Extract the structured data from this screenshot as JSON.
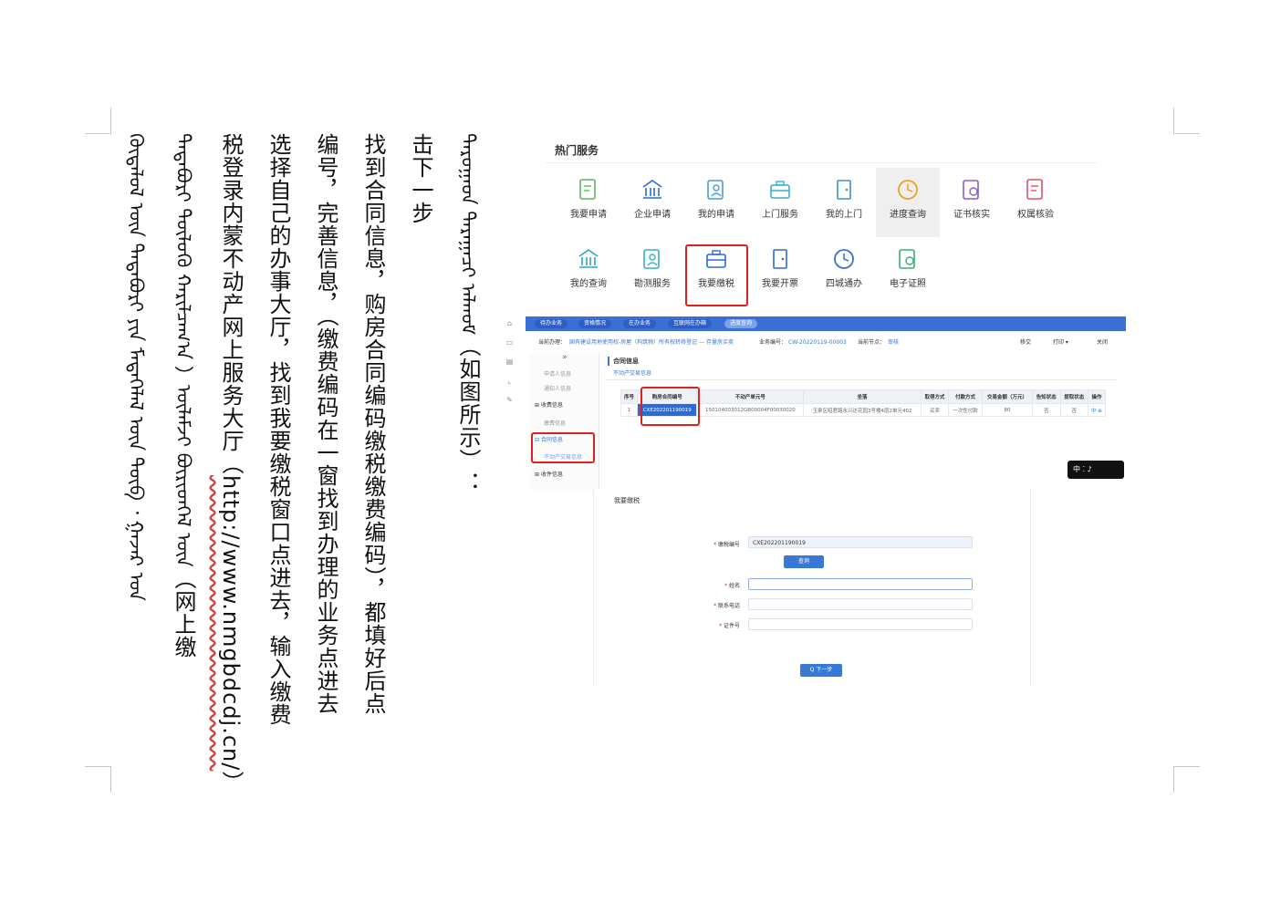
{
  "text": {
    "col1": "ᠳᠠᠷᠤᠭᠠᠳ ᠳᠠᠷᠠᠭᠠᠴᠢ ᠠᠯᠬᠤᠮ",
    "col1_rest": "（如图所示）：",
    "col2": "击下一步",
    "col3": "找到合同信息，购房合同编码缴税缴费编码），都填好后点",
    "col4": "编号，完善信息，（缴费编码在一窗找到办理的业务点进去",
    "col5": "选择自己的办事大厅，找到我要缴税窗口点进去，输入缴费",
    "col6a": "税登录内蒙不动产网上服务大厅（",
    "col6_link": "http://www.nmgbdcdj.cn/",
    "col6b": "）",
    "col7a": "ᠲᠠᠲᠠᠪᠤᠷᠢ ᠲᠥᠯᠥᠬᠦ ᠬᠠᠷᠢᠯᠴᠠᠭ᠎ᠠ ）ᠦᠯᠡᠮᠵᠢ ᠪᠦᠷᠢᠳᠬᠡᠯ ᠦᠨ",
    "col7b": "（网上缴",
    "col8": "ᠬᠥᠳᠡᠯᠦᠯ ᠦᠨ ᠲᠠᠲᠠᠪᠤᠷᠢ ᠶᠢᠨ ᠮᠡᠳᠡᠭᠡᠯᠡᠯ ᠦᠨ ᠲᠦᠪ ᠂ ᠭᠠᠵᠠᠷ ᠤᠨ"
  },
  "shot1": {
    "title": "热门服务",
    "items": [
      {
        "label": "我要申请",
        "icon": "edit-doc-icon",
        "color": "#5cb85c"
      },
      {
        "label": "企业申请",
        "icon": "building-icon",
        "color": "#2c6bd6"
      },
      {
        "label": "我的申请",
        "icon": "user-doc-icon",
        "color": "#4a9ad8"
      },
      {
        "label": "上门服务",
        "icon": "briefcase-icon",
        "color": "#35b0c8"
      },
      {
        "label": "我的上门",
        "icon": "door-icon",
        "color": "#3c8fd6"
      },
      {
        "label": "进度查询",
        "icon": "clock-icon",
        "color": "#f0a020"
      },
      {
        "label": "证书核实",
        "icon": "cert-search-icon",
        "color": "#8a5cc8"
      },
      {
        "label": "权属核验",
        "icon": "doc-badge-icon",
        "color": "#e05060"
      },
      {
        "label": "我的查询",
        "icon": "doc-search-icon",
        "color": "#35a0c8"
      },
      {
        "label": "勘测服务",
        "icon": "toolbox-icon",
        "color": "#35b0c8"
      },
      {
        "label": "我要缴税",
        "icon": "bank-icon",
        "color": "#2c6bd6"
      },
      {
        "label": "我要开票",
        "icon": "list-icon",
        "color": "#2c6bd6"
      },
      {
        "label": "四城通办",
        "icon": "city-grid-icon",
        "color": "#3c6fd6"
      },
      {
        "label": "电子证照",
        "icon": "id-card-icon",
        "color": "#35b070"
      }
    ]
  },
  "shot2": {
    "tabs": [
      "待办业务",
      "资格情况",
      "在办业务",
      "互联网在办箱",
      "进度查询"
    ],
    "crumb_label": "当前办理：",
    "crumb_path": "国有建设用地使用权-房屋（构筑物）所有权转移登记 — 存量房买卖",
    "biz_label": "业务编号：",
    "biz_value": "CW-20220119-00003",
    "node_label": "当前节点：",
    "node_value": "审核",
    "actions": [
      "移交",
      "打印 ▾",
      "关闭"
    ],
    "side_items": [
      "申请人信息",
      "通知人信息",
      "收费信息",
      "缴费信息",
      "合同信息",
      "不动产交易信息",
      "收件信息"
    ],
    "section_title": "合同信息",
    "section_sub": "不动产交易信息",
    "columns": [
      "序号",
      "购房合同编号",
      "不动产单元号",
      "坐落",
      "取得方式",
      "付款方式",
      "交易金额（万元）",
      "告知状态",
      "提取状态",
      "操作"
    ],
    "row": [
      "1",
      "CXE202201190019",
      "150104003012GB00004F00030020",
      "玉泉区昭君路永兴达花园3号楼4层2单元402",
      "买卖",
      "一次性付款",
      "80",
      "否",
      "否",
      "中 ⊕"
    ],
    "badge": "中 ⁚ ♪"
  },
  "shot3": {
    "title": "我要缴税",
    "fields": [
      {
        "label": "缴税编号",
        "value": "CXE202201190019"
      },
      {
        "label": "姓名",
        "value": ""
      },
      {
        "label": "联系电话",
        "value": ""
      },
      {
        "label": "证件号",
        "value": ""
      }
    ],
    "query_btn": "查询",
    "next_btn": "Q 下一步"
  }
}
